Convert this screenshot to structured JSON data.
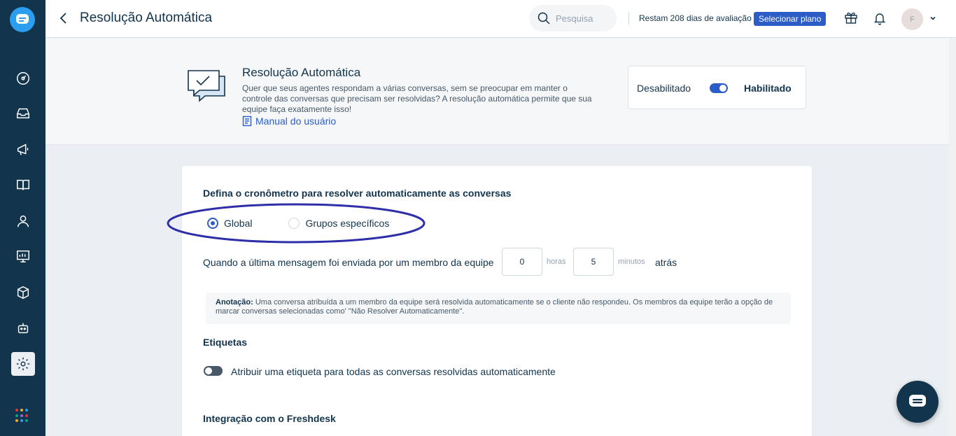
{
  "topbar": {
    "title": "Resolução Automática",
    "search_placeholder": "Pesquisa",
    "trial_text": "Restam 208 dias de avaliação",
    "plan_button": "Selecionar plano",
    "avatar_initial": "F"
  },
  "sidebar": {
    "items": [
      {
        "icon": "dashboard-icon"
      },
      {
        "icon": "inbox-icon"
      },
      {
        "icon": "campaigns-icon"
      },
      {
        "icon": "knowledge-base-icon"
      },
      {
        "icon": "contacts-icon"
      },
      {
        "icon": "reports-icon"
      },
      {
        "icon": "integrations-icon"
      },
      {
        "icon": "bot-icon"
      },
      {
        "icon": "settings-icon",
        "active": true
      }
    ],
    "app_dot_colors": [
      "#e43538",
      "#f8ab21",
      "#2c9ef0",
      "#00a886",
      "#a35ee8",
      "#e43538",
      "#f8ab21",
      "#2c9ef0",
      "#00a886"
    ]
  },
  "header": {
    "title": "Resolução Automática",
    "description": "Quer que seus agentes respondam a várias conversas, sem se preocupar em manter o controle das conversas que precisam ser resolvidas? A resolução automática permite que sua equipe faça exatamente isso!",
    "manual_link": "Manual do usuário",
    "toggle_off_label": "Desabilitado",
    "toggle_on_label": "Habilitado",
    "enabled": true
  },
  "timer": {
    "section_title": "Defina o cronômetro para resolver automaticamente as conversas",
    "radio_global": "Global",
    "radio_groups": "Grupos específicos",
    "selected": "Global",
    "when_label": "Quando a última mensagem foi enviada por um membro da equipe",
    "hours_value": "0",
    "hours_label": "horas",
    "minutes_value": "5",
    "minutes_label": "minutos",
    "ago_label": "atrás"
  },
  "note": {
    "prefix": "Anotação:",
    "text": " Uma conversa atribuída a um membro da equipe será resolvida automaticamente se o cliente não respondeu. Os membros da equipe terão a opção de marcar conversas selecionadas como' \"Não Resolver Automaticamente\"."
  },
  "labels": {
    "section_title": "Etiquetas",
    "toggle_label": "Atribuir uma etiqueta para todas as conversas resolvidas automaticamente",
    "enabled": false
  },
  "freshdesk": {
    "section_title": "Integração com o Freshdesk"
  },
  "colors": {
    "sidebar_bg": "#12344d",
    "accent": "#2c5cc5",
    "annotation_ellipse": "#2e2ea8"
  }
}
